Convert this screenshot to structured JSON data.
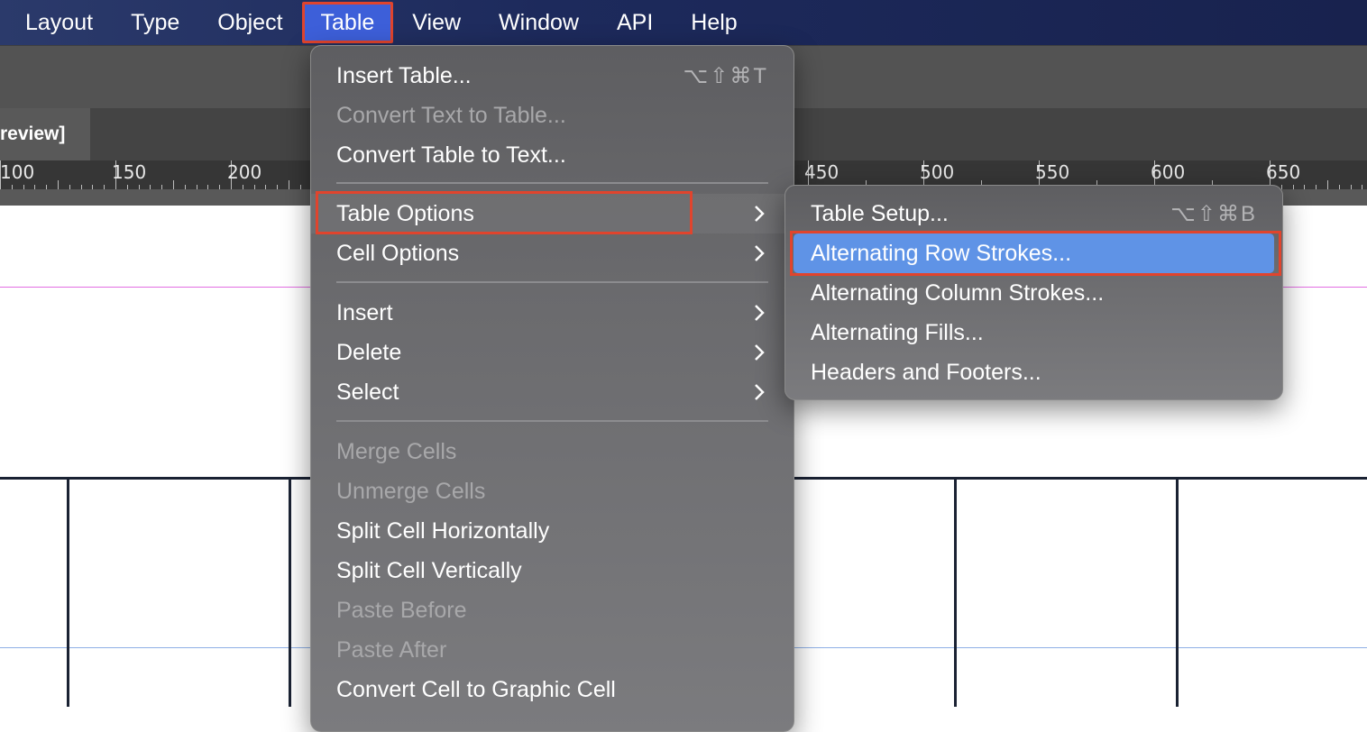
{
  "menubar": {
    "items": [
      "Layout",
      "Type",
      "Object",
      "Table",
      "View",
      "Window",
      "API",
      "Help"
    ],
    "active": "Table"
  },
  "document_tab": {
    "title": "review]"
  },
  "ruler": {
    "labels": [
      "100",
      "150",
      "200",
      "450",
      "500",
      "550",
      "600",
      "650"
    ]
  },
  "table_menu": {
    "insert_table": {
      "label": "Insert Table...",
      "shortcut": "⌥⇧⌘T"
    },
    "convert_text_to_table": "Convert Text to Table...",
    "convert_table_to_text": "Convert Table to Text...",
    "table_options": "Table Options",
    "cell_options": "Cell Options",
    "insert": "Insert",
    "delete": "Delete",
    "select": "Select",
    "merge_cells": "Merge Cells",
    "unmerge_cells": "Unmerge Cells",
    "split_horizontally": "Split Cell Horizontally",
    "split_vertically": "Split Cell Vertically",
    "paste_before": "Paste Before",
    "paste_after": "Paste After",
    "convert_to_graphic": "Convert Cell to Graphic Cell"
  },
  "table_options_submenu": {
    "table_setup": {
      "label": "Table Setup...",
      "shortcut": "⌥⇧⌘B"
    },
    "alternating_row_strokes": "Alternating Row Strokes...",
    "alternating_column_strokes": "Alternating Column Strokes...",
    "alternating_fills": "Alternating Fills...",
    "headers_and_footers": "Headers and Footers..."
  },
  "colors": {
    "highlight": "#5f93e6",
    "annotation_box": "#e0442d",
    "menubar": "#1d2a5c"
  }
}
